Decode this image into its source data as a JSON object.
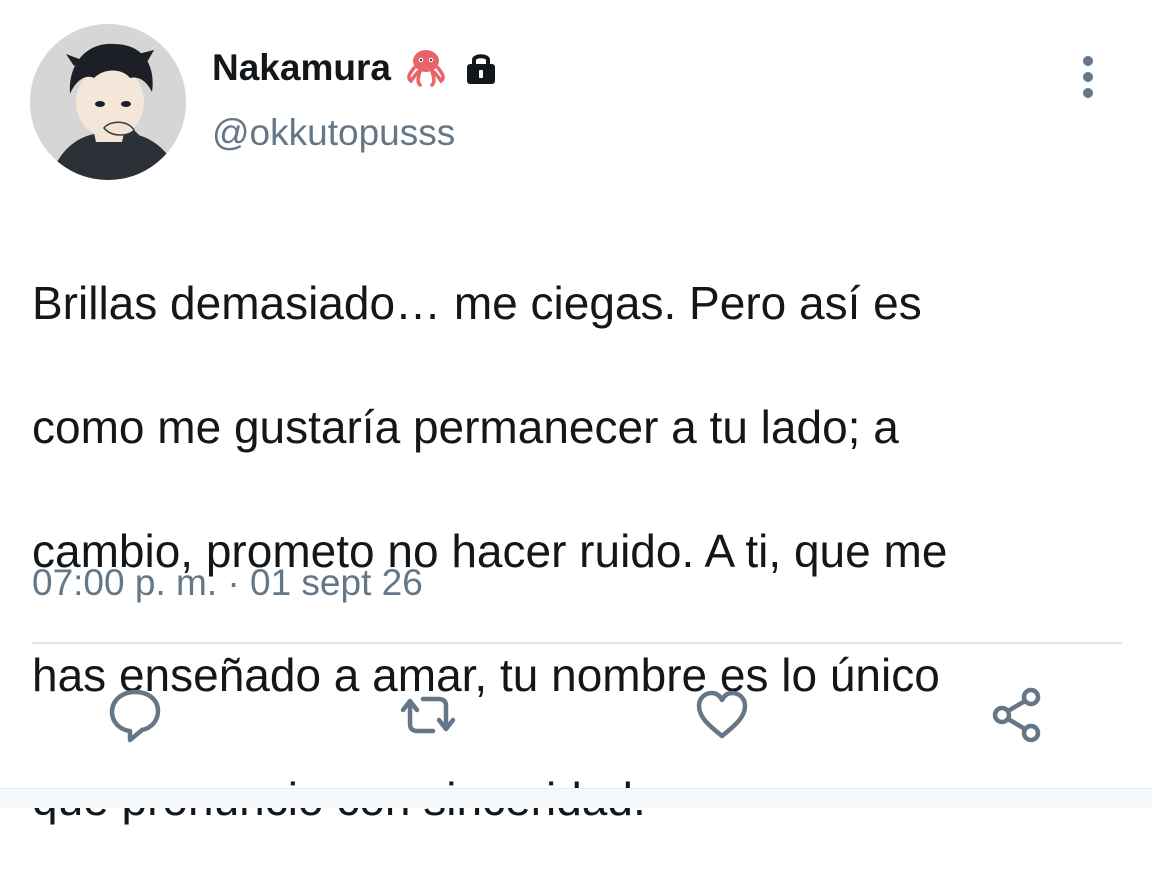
{
  "user": {
    "display_name": "Nakamura",
    "handle": "@okkutopusss",
    "badges": [
      "octopus-icon",
      "lock-icon"
    ]
  },
  "tweet": {
    "text_lines": [
      "Brillas demasiado… me ciegas. Pero así es",
      "como me gustaría permanecer a tu lado; a",
      "cambio, prometo no hacer ruido. A ti, que me",
      "has enseñado a amar, tu nombre es lo único",
      "que pronuncio con sinceridad."
    ],
    "time": "07:00 p. m.",
    "separator": " · ",
    "date": "01 sept 26"
  },
  "actions": [
    "reply-icon",
    "retweet-icon",
    "like-icon",
    "share-icon"
  ],
  "colors": {
    "text": "#14171a",
    "secondary": "#657786",
    "divider": "#e1e8ed",
    "octopus": "#e8646b"
  }
}
